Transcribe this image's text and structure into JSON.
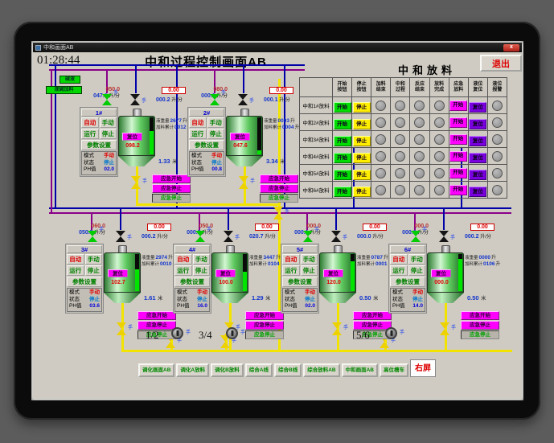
{
  "window": {
    "title": "中和画面AB",
    "close_glyph": "x"
  },
  "header": {
    "time": "01:28:44",
    "title": "中和过程控制画面AB",
    "table_title": "中和放料",
    "exit_label": "退出"
  },
  "feed_labels": [
    "碱液",
    "液碱加料"
  ],
  "units": {
    "flow": "升/分",
    "liters": "升",
    "meters": "米",
    "hand": "手"
  },
  "labels": {
    "auto": "自动",
    "manual": "手动",
    "run": "运行",
    "stop": "停止",
    "params": "参数设置",
    "mode": "模式",
    "state": "状态",
    "ph": "PH值",
    "reset": "复位",
    "weight": "液重量",
    "total": "加料累计"
  },
  "emergency": {
    "start": "应急开始",
    "stop": "应急停止",
    "stop2": "应急停止"
  },
  "tanks": [
    {
      "id": "1#",
      "sp": "050.0",
      "pv": "047.1",
      "box": "0.00",
      "flow2": "000.2",
      "weight": "2677",
      "total": "0012",
      "level": "1.33",
      "tank_value": "098.2",
      "mode": "手动",
      "state": "停止",
      "ph": "02.0",
      "fill": 62
    },
    {
      "id": "2#",
      "sp": "080.0",
      "pv": "000.1",
      "box": "0.00",
      "flow2": "000.1",
      "weight": "0003",
      "total": "0004",
      "level": "3.34",
      "tank_value": "047.6",
      "mode": "手动",
      "state": "停止",
      "ph": "00.8",
      "fill": 10
    },
    {
      "id": "3#",
      "sp": "060.0",
      "pv": "050.5",
      "box": "0.00",
      "flow2": "000.2",
      "weight": "2974",
      "total": "0010",
      "level": "1.61",
      "tank_value": "102.7",
      "mode": "手动",
      "state": "停止",
      "ph": "03.6",
      "fill": 58
    },
    {
      "id": "4#",
      "sp": "050.0",
      "pv": "000.3",
      "box": "0.00",
      "flow2": "020.7",
      "weight": "3447",
      "total": "0104",
      "level": "1.29",
      "tank_value": "100.0",
      "mode": "手动",
      "state": "停止",
      "ph": "16.0",
      "fill": 52
    },
    {
      "id": "5#",
      "sp": "000.0",
      "pv": "000.1",
      "box": "0.00",
      "flow2": "000.0",
      "weight": "0787",
      "total": "0001",
      "level": "0.50",
      "tank_value": "120.0",
      "mode": "手动",
      "state": "停止",
      "ph": "02.0",
      "fill": 80
    },
    {
      "id": "6#",
      "sp": "000.0",
      "pv": "000.0",
      "box": "0.00",
      "flow2": "000.2",
      "weight": "0000",
      "total": "0106",
      "level": "0.50",
      "tank_value": "000.0",
      "mode": "手动",
      "state": "停止",
      "ph": "14.0",
      "fill": 88
    }
  ],
  "table": {
    "headers": [
      [
        "开始",
        "按钮"
      ],
      [
        "停止",
        "按钮"
      ],
      [
        "加料",
        "结束"
      ],
      [
        "中和",
        "过程"
      ],
      [
        "反应",
        "结束"
      ],
      [
        "放料",
        "完成"
      ],
      [
        "应急",
        "放料"
      ],
      [
        "液位",
        "复位"
      ],
      [
        "液位",
        "报警"
      ]
    ],
    "row_labels": [
      "中和1#放料",
      "中和2#放料",
      "中和3#放料",
      "中和4#放料",
      "中和5#放料",
      "中和6#放料"
    ],
    "start_label": "开始",
    "stop_label": "停止",
    "emg_label": "开始",
    "reset_label": "复位"
  },
  "pumps": [
    "1/2",
    "3/4",
    "5/6"
  ],
  "nav": [
    "调化画面AB",
    "调化A放料",
    "调化B放料",
    "综合A线",
    "综合B线",
    "综合放料AB",
    "中和画面AB",
    "高位槽车",
    "右屏"
  ],
  "colors": {
    "start_green": "#00dd00",
    "stop_yellow": "#ffee00",
    "emergency_magenta": "#ff00ff",
    "reset_purple": "#7a00e0",
    "pipe_yellow": "#f2e400",
    "pipe_blue": "#0000a8",
    "pipe_purple": "#8a008a",
    "level_green": "#00e400",
    "alarm_red": "#cc0000"
  }
}
